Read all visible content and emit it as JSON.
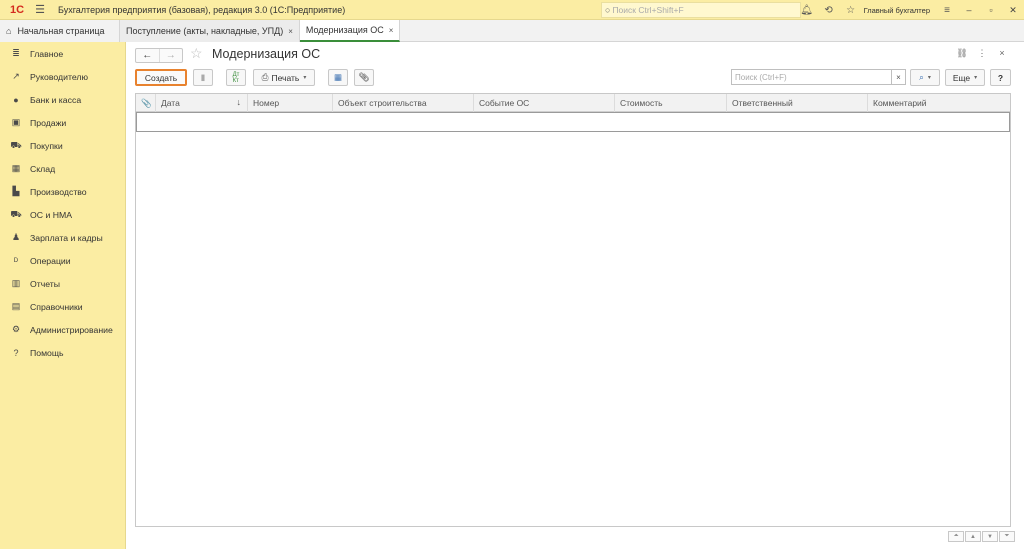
{
  "titlebar": {
    "logo": "1С",
    "title": "Бухгалтерия предприятия (базовая), редакция 3.0  (1С:Предприятие)",
    "search_placeholder": "Поиск Ctrl+Shift+F",
    "user": "Главный бухгалтер"
  },
  "tabs": {
    "home": "Начальная страница",
    "items": [
      {
        "label": "Поступление (акты, накладные, УПД)",
        "close": "×"
      },
      {
        "label": "Модернизация ОС",
        "close": "×"
      }
    ]
  },
  "sidebar": {
    "items": [
      {
        "label": "Главное",
        "icon": "≣"
      },
      {
        "label": "Руководителю",
        "icon": "↗"
      },
      {
        "label": "Банк и касса",
        "icon": "●"
      },
      {
        "label": "Продажи",
        "icon": "▣"
      },
      {
        "label": "Покупки",
        "icon": "⛟"
      },
      {
        "label": "Склад",
        "icon": "▦"
      },
      {
        "label": "Производство",
        "icon": "▙"
      },
      {
        "label": "ОС и НМА",
        "icon": "⛟"
      },
      {
        "label": "Зарплата и кадры",
        "icon": "♟"
      },
      {
        "label": "Операции",
        "icon": "ᴰ"
      },
      {
        "label": "Отчеты",
        "icon": "▥"
      },
      {
        "label": "Справочники",
        "icon": "▤"
      },
      {
        "label": "Администрирование",
        "icon": "⚙"
      },
      {
        "label": "Помощь",
        "icon": "?"
      }
    ]
  },
  "page": {
    "title": "Модернизация ОС",
    "back": "←",
    "forward": "→",
    "star": "☆",
    "link_icon": "🔗",
    "menu_icon": "⋮",
    "close_icon": "×"
  },
  "toolbar": {
    "create": "Создать",
    "print": "Печать",
    "print_caret": "▾",
    "search_placeholder": "Поиск (Ctrl+F)",
    "search_clear": "×",
    "search_btn": "⌕",
    "more": "Еще",
    "more_caret": "▾",
    "help": "?"
  },
  "table": {
    "columns": [
      {
        "label": "📎"
      },
      {
        "label": "Дата",
        "sort": "↓"
      },
      {
        "label": "Номер"
      },
      {
        "label": "Объект строительства"
      },
      {
        "label": "Событие ОС"
      },
      {
        "label": "Стоимость"
      },
      {
        "label": "Ответственный"
      },
      {
        "label": "Комментарий"
      }
    ]
  },
  "scroll": [
    "⏶",
    "▲",
    "▼",
    "⏷"
  ]
}
